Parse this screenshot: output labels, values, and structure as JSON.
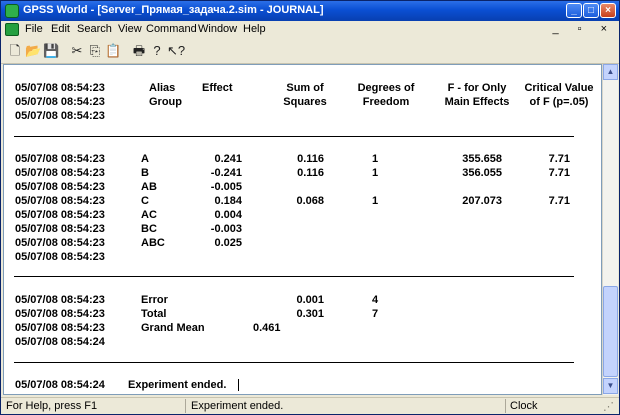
{
  "window": {
    "title": "GPSS World - [Server_Прямая_задача.2.sim - JOURNAL]"
  },
  "menu": {
    "items": [
      "File",
      "Edit",
      "Search",
      "View",
      "Command",
      "Window",
      "Help"
    ]
  },
  "toolbar": {
    "icons": [
      "new-icon",
      "open-icon",
      "save-icon",
      "cut-icon",
      "copy-icon",
      "paste-icon",
      "print-icon",
      "help-icon",
      "context-help-icon"
    ]
  },
  "journal": {
    "header": {
      "ts": [
        "05/07/08 08:54:23",
        "05/07/08 08:54:23",
        "05/07/08 08:54:23"
      ],
      "alias": [
        "Alias",
        "Group"
      ],
      "effect": "Effect",
      "ss": [
        "Sum of",
        "Squares"
      ],
      "df": [
        "Degrees of",
        "Freedom"
      ],
      "f": [
        "F - for Only",
        "Main Effects"
      ],
      "crit": [
        "Critical Value",
        "of F (p=.05)"
      ]
    },
    "rows": [
      {
        "ts": "05/07/08 08:54:23",
        "alias": "A",
        "effect": "0.241",
        "ss": "0.116",
        "df": "1",
        "f": "355.658",
        "crit": "7.71"
      },
      {
        "ts": "05/07/08 08:54:23",
        "alias": "B",
        "effect": "-0.241",
        "ss": "0.116",
        "df": "1",
        "f": "356.055",
        "crit": "7.71"
      },
      {
        "ts": "05/07/08 08:54:23",
        "alias": "AB",
        "effect": "-0.005",
        "ss": "",
        "df": "",
        "f": "",
        "crit": ""
      },
      {
        "ts": "05/07/08 08:54:23",
        "alias": "C",
        "effect": "0.184",
        "ss": "0.068",
        "df": "1",
        "f": "207.073",
        "crit": "7.71"
      },
      {
        "ts": "05/07/08 08:54:23",
        "alias": "AC",
        "effect": "0.004",
        "ss": "",
        "df": "",
        "f": "",
        "crit": ""
      },
      {
        "ts": "05/07/08 08:54:23",
        "alias": "BC",
        "effect": "-0.003",
        "ss": "",
        "df": "",
        "f": "",
        "crit": ""
      },
      {
        "ts": "05/07/08 08:54:23",
        "alias": "ABC",
        "effect": "0.025",
        "ss": "",
        "df": "",
        "f": "",
        "crit": ""
      },
      {
        "ts": "05/07/08 08:54:23",
        "alias": "",
        "effect": "",
        "ss": "",
        "df": "",
        "f": "",
        "crit": ""
      }
    ],
    "summary": {
      "error": {
        "ts": "05/07/08 08:54:23",
        "label": "Error",
        "ss": "0.001",
        "df": "4"
      },
      "total": {
        "ts": "05/07/08 08:54:23",
        "label": "Total",
        "ss": "0.301",
        "df": "7"
      },
      "mean": {
        "ts": "05/07/08 08:54:23",
        "label": "Grand Mean",
        "value": "0.461"
      },
      "blank_ts": "05/07/08 08:54:24"
    },
    "ended": {
      "ts": "05/07/08 08:54:24",
      "text": "Experiment ended."
    }
  },
  "status": {
    "help": "For Help, press F1",
    "message": "Experiment ended.",
    "clock": "Clock"
  }
}
